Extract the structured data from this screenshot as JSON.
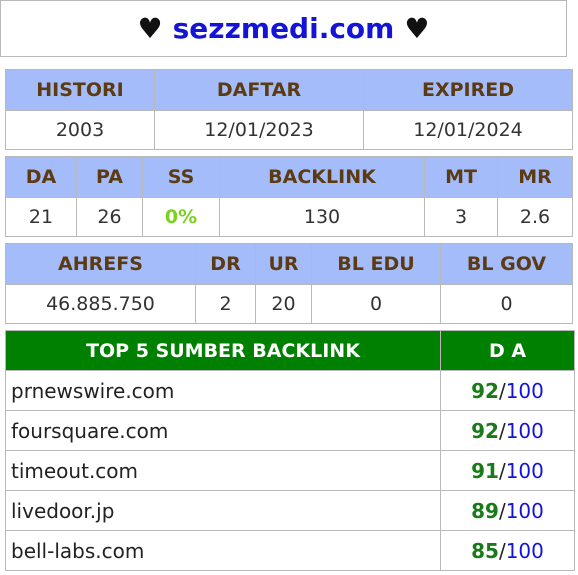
{
  "title": {
    "heart_left": "♥",
    "domain": "sezzmedi.com",
    "heart_right": "♥"
  },
  "registration": {
    "headers": [
      "HISTORI",
      "DAFTAR",
      "EXPIRED"
    ],
    "values": [
      "2003",
      "12/01/2023",
      "12/01/2024"
    ]
  },
  "metrics": {
    "headers": [
      "DA",
      "PA",
      "SS",
      "BACKLINK",
      "MT",
      "MR"
    ],
    "values": [
      "21",
      "26",
      "0%",
      "130",
      "3",
      "2.6"
    ]
  },
  "ahrefs": {
    "headers": [
      "AHREFS",
      "DR",
      "UR",
      "BL EDU",
      "BL GOV"
    ],
    "values": [
      "46.885.750",
      "2",
      "20",
      "0",
      "0"
    ]
  },
  "backlinks": {
    "header_source": "TOP 5 SUMBER BACKLINK",
    "header_da": "D A",
    "rows": [
      {
        "site": "prnewswire.com",
        "da": "92",
        "sep": "/",
        "max": "100"
      },
      {
        "site": "foursquare.com",
        "da": "92",
        "sep": "/",
        "max": "100"
      },
      {
        "site": "timeout.com",
        "da": "91",
        "sep": "/",
        "max": "100"
      },
      {
        "site": "livedoor.jp",
        "da": "89",
        "sep": "/",
        "max": "100"
      },
      {
        "site": "bell-labs.com",
        "da": "85",
        "sep": "/",
        "max": "100"
      }
    ]
  },
  "colors": {
    "header_bg": "#a5bcfa",
    "header_text": "#5c3a12",
    "top5_header_bg": "#008000",
    "domain_text": "#1414d6",
    "ss_value": "#7bd11e",
    "da_value": "#1a7a1a"
  }
}
